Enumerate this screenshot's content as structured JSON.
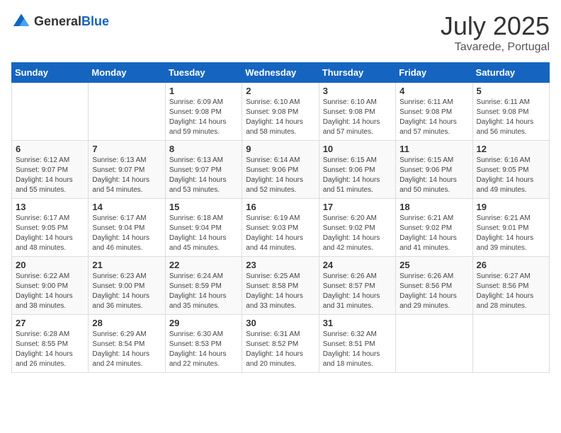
{
  "header": {
    "logo_general": "General",
    "logo_blue": "Blue",
    "month": "July 2025",
    "location": "Tavarede, Portugal"
  },
  "calendar": {
    "days_of_week": [
      "Sunday",
      "Monday",
      "Tuesday",
      "Wednesday",
      "Thursday",
      "Friday",
      "Saturday"
    ],
    "weeks": [
      [
        {
          "day": "",
          "info": ""
        },
        {
          "day": "",
          "info": ""
        },
        {
          "day": "1",
          "info": "Sunrise: 6:09 AM\nSunset: 9:08 PM\nDaylight: 14 hours\nand 59 minutes."
        },
        {
          "day": "2",
          "info": "Sunrise: 6:10 AM\nSunset: 9:08 PM\nDaylight: 14 hours\nand 58 minutes."
        },
        {
          "day": "3",
          "info": "Sunrise: 6:10 AM\nSunset: 9:08 PM\nDaylight: 14 hours\nand 57 minutes."
        },
        {
          "day": "4",
          "info": "Sunrise: 6:11 AM\nSunset: 9:08 PM\nDaylight: 14 hours\nand 57 minutes."
        },
        {
          "day": "5",
          "info": "Sunrise: 6:11 AM\nSunset: 9:08 PM\nDaylight: 14 hours\nand 56 minutes."
        }
      ],
      [
        {
          "day": "6",
          "info": "Sunrise: 6:12 AM\nSunset: 9:07 PM\nDaylight: 14 hours\nand 55 minutes."
        },
        {
          "day": "7",
          "info": "Sunrise: 6:13 AM\nSunset: 9:07 PM\nDaylight: 14 hours\nand 54 minutes."
        },
        {
          "day": "8",
          "info": "Sunrise: 6:13 AM\nSunset: 9:07 PM\nDaylight: 14 hours\nand 53 minutes."
        },
        {
          "day": "9",
          "info": "Sunrise: 6:14 AM\nSunset: 9:06 PM\nDaylight: 14 hours\nand 52 minutes."
        },
        {
          "day": "10",
          "info": "Sunrise: 6:15 AM\nSunset: 9:06 PM\nDaylight: 14 hours\nand 51 minutes."
        },
        {
          "day": "11",
          "info": "Sunrise: 6:15 AM\nSunset: 9:06 PM\nDaylight: 14 hours\nand 50 minutes."
        },
        {
          "day": "12",
          "info": "Sunrise: 6:16 AM\nSunset: 9:05 PM\nDaylight: 14 hours\nand 49 minutes."
        }
      ],
      [
        {
          "day": "13",
          "info": "Sunrise: 6:17 AM\nSunset: 9:05 PM\nDaylight: 14 hours\nand 48 minutes."
        },
        {
          "day": "14",
          "info": "Sunrise: 6:17 AM\nSunset: 9:04 PM\nDaylight: 14 hours\nand 46 minutes."
        },
        {
          "day": "15",
          "info": "Sunrise: 6:18 AM\nSunset: 9:04 PM\nDaylight: 14 hours\nand 45 minutes."
        },
        {
          "day": "16",
          "info": "Sunrise: 6:19 AM\nSunset: 9:03 PM\nDaylight: 14 hours\nand 44 minutes."
        },
        {
          "day": "17",
          "info": "Sunrise: 6:20 AM\nSunset: 9:02 PM\nDaylight: 14 hours\nand 42 minutes."
        },
        {
          "day": "18",
          "info": "Sunrise: 6:21 AM\nSunset: 9:02 PM\nDaylight: 14 hours\nand 41 minutes."
        },
        {
          "day": "19",
          "info": "Sunrise: 6:21 AM\nSunset: 9:01 PM\nDaylight: 14 hours\nand 39 minutes."
        }
      ],
      [
        {
          "day": "20",
          "info": "Sunrise: 6:22 AM\nSunset: 9:00 PM\nDaylight: 14 hours\nand 38 minutes."
        },
        {
          "day": "21",
          "info": "Sunrise: 6:23 AM\nSunset: 9:00 PM\nDaylight: 14 hours\nand 36 minutes."
        },
        {
          "day": "22",
          "info": "Sunrise: 6:24 AM\nSunset: 8:59 PM\nDaylight: 14 hours\nand 35 minutes."
        },
        {
          "day": "23",
          "info": "Sunrise: 6:25 AM\nSunset: 8:58 PM\nDaylight: 14 hours\nand 33 minutes."
        },
        {
          "day": "24",
          "info": "Sunrise: 6:26 AM\nSunset: 8:57 PM\nDaylight: 14 hours\nand 31 minutes."
        },
        {
          "day": "25",
          "info": "Sunrise: 6:26 AM\nSunset: 8:56 PM\nDaylight: 14 hours\nand 29 minutes."
        },
        {
          "day": "26",
          "info": "Sunrise: 6:27 AM\nSunset: 8:56 PM\nDaylight: 14 hours\nand 28 minutes."
        }
      ],
      [
        {
          "day": "27",
          "info": "Sunrise: 6:28 AM\nSunset: 8:55 PM\nDaylight: 14 hours\nand 26 minutes."
        },
        {
          "day": "28",
          "info": "Sunrise: 6:29 AM\nSunset: 8:54 PM\nDaylight: 14 hours\nand 24 minutes."
        },
        {
          "day": "29",
          "info": "Sunrise: 6:30 AM\nSunset: 8:53 PM\nDaylight: 14 hours\nand 22 minutes."
        },
        {
          "day": "30",
          "info": "Sunrise: 6:31 AM\nSunset: 8:52 PM\nDaylight: 14 hours\nand 20 minutes."
        },
        {
          "day": "31",
          "info": "Sunrise: 6:32 AM\nSunset: 8:51 PM\nDaylight: 14 hours\nand 18 minutes."
        },
        {
          "day": "",
          "info": ""
        },
        {
          "day": "",
          "info": ""
        }
      ]
    ]
  }
}
